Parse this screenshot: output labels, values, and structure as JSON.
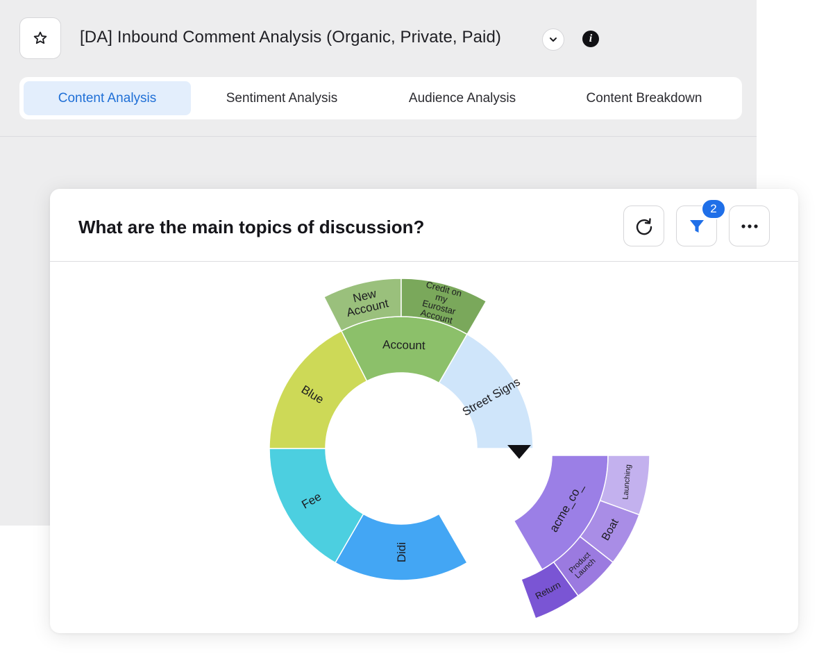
{
  "header": {
    "title": "[DA] Inbound Comment Analysis (Organic, Private, Paid)",
    "star_icon": "star-icon",
    "chevron_icon": "chevron-down-icon",
    "info_icon": "info-icon",
    "info_glyph": "i"
  },
  "tabs": [
    {
      "label": "Content Analysis",
      "active": true
    },
    {
      "label": "Sentiment Analysis",
      "active": false
    },
    {
      "label": "Audience Analysis",
      "active": false
    },
    {
      "label": "Content Breakdown",
      "active": false
    }
  ],
  "widget": {
    "title": "What are the main topics of discussion?",
    "refresh_icon": "refresh-icon",
    "filter_icon": "filter-icon",
    "filter_badge": "2",
    "more_icon": "more-icon"
  },
  "chart_data": {
    "type": "sunburst",
    "inner_ring": [
      {
        "label": "Account",
        "color": "#8cc06a"
      },
      {
        "label": "Street Signs",
        "color": "#cfe5fa"
      },
      {
        "label": "acme_co_",
        "color": "#9b7fe6"
      },
      {
        "label": "Didi",
        "color": "#43a6f4"
      },
      {
        "label": "Fee",
        "color": "#4ccfe0"
      },
      {
        "label": "Blue",
        "color": "#cdd957"
      }
    ],
    "outer_ring": [
      {
        "parent": "Account",
        "label": "New Account",
        "color": "#9ac07c"
      },
      {
        "parent": "Account",
        "label": "Credit on my Eurostar Account",
        "color": "#7aa85b"
      },
      {
        "parent": "acme_co_",
        "label": "Launching",
        "color": "#c3b1ee"
      },
      {
        "parent": "acme_co_",
        "label": "Boat",
        "color": "#a98de6"
      },
      {
        "parent": "acme_co_",
        "label": "Product Launch",
        "color": "#9b7ae0"
      },
      {
        "parent": "acme_co_",
        "label": "Return",
        "color": "#7a55d4"
      }
    ],
    "selected": "acme_co_"
  }
}
